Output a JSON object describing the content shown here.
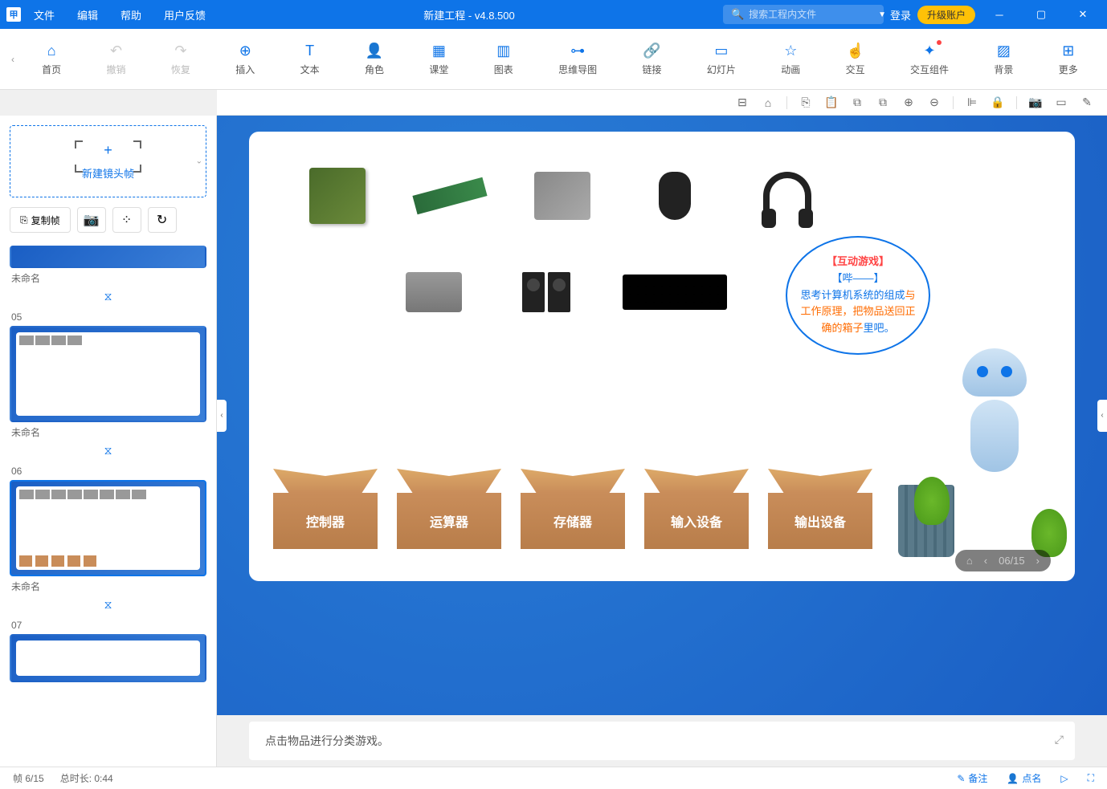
{
  "titlebar": {
    "menus": [
      "文件",
      "编辑",
      "帮助",
      "用户反馈"
    ],
    "title": "新建工程 - v4.8.500",
    "search_placeholder": "搜索工程内文件",
    "login": "登录",
    "upgrade": "升级账户"
  },
  "ribbon": {
    "items": [
      {
        "icon": "⌂",
        "label": "首页"
      },
      {
        "icon": "↶",
        "label": "撤销",
        "disabled": true
      },
      {
        "icon": "↷",
        "label": "恢复",
        "disabled": true
      },
      {
        "icon": "⊕",
        "label": "插入"
      },
      {
        "icon": "T",
        "label": "文本"
      },
      {
        "icon": "👤",
        "label": "角色"
      },
      {
        "icon": "▦",
        "label": "课堂"
      },
      {
        "icon": "▥",
        "label": "图表"
      },
      {
        "icon": "⊶",
        "label": "思维导图"
      },
      {
        "icon": "🔗",
        "label": "链接"
      },
      {
        "icon": "▭",
        "label": "幻灯片"
      },
      {
        "icon": "☆",
        "label": "动画"
      },
      {
        "icon": "☝",
        "label": "交互"
      },
      {
        "icon": "✦",
        "label": "交互组件",
        "notif": true
      },
      {
        "icon": "▨",
        "label": "背景"
      },
      {
        "icon": "⊞",
        "label": "更多"
      }
    ]
  },
  "sidebar": {
    "new_frame": "新建镜头帧",
    "copy_frame": "复制帧",
    "frames": [
      {
        "num": "",
        "label": "未命名",
        "small": true
      },
      {
        "num": "05",
        "label": "未命名"
      },
      {
        "num": "06",
        "label": "未命名",
        "active": true
      },
      {
        "num": "07",
        "label": ""
      }
    ]
  },
  "slide": {
    "bubble": {
      "title": "【互动游戏】",
      "sub": "【哔——】",
      "line1_blue": "思考计算机系统的组成",
      "line1_orange": "与工作原理，",
      "line2_orange": "把物品送回正确的箱子",
      "line2_blue": "里吧。"
    },
    "boxes": [
      "控制器",
      "运算器",
      "存储器",
      "输入设备",
      "输出设备"
    ],
    "nav_counter": "06/15",
    "hint": "点击物品进行分类游戏。"
  },
  "statusbar": {
    "frame_info": "帧 6/15",
    "duration": "总时长: 0:44",
    "notes": "备注",
    "roll_call": "点名"
  }
}
